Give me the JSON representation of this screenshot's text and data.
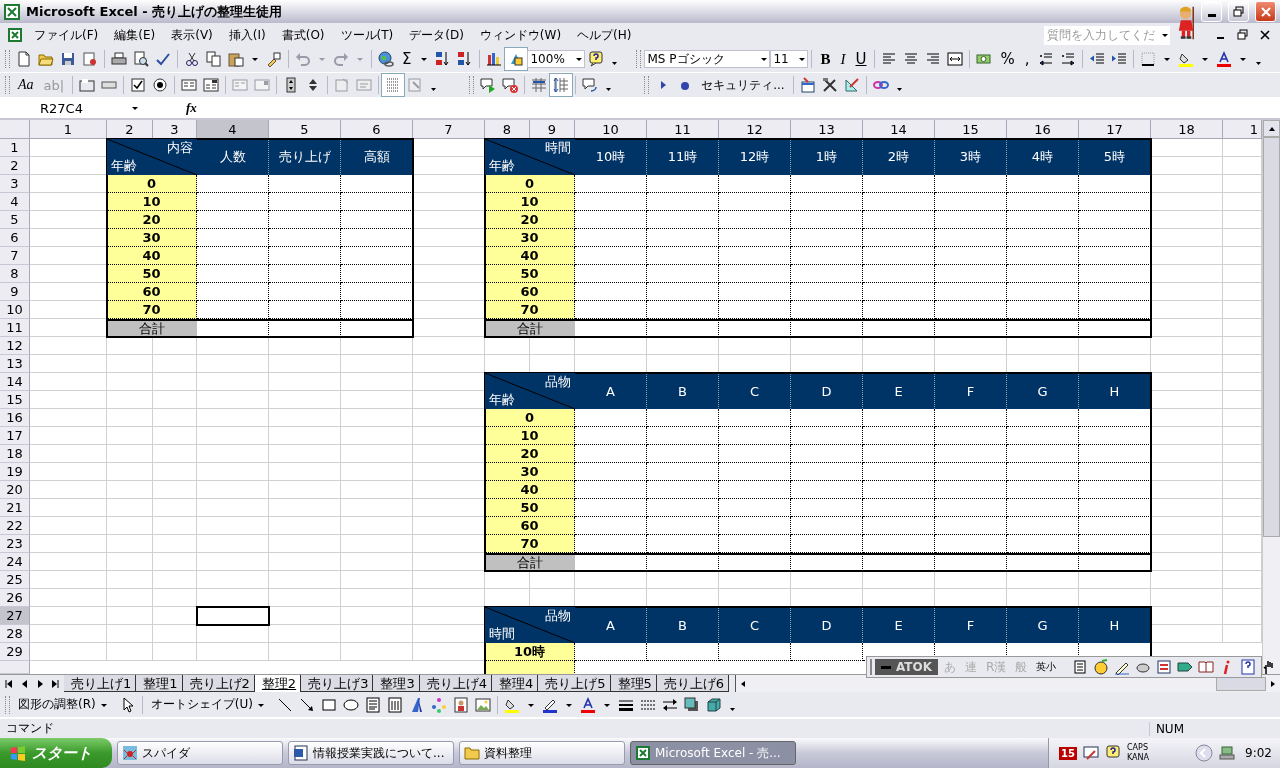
{
  "window": {
    "title": "Microsoft Excel - 売り上げの整理生徒用"
  },
  "menu": [
    "ファイル(F)",
    "編集(E)",
    "表示(V)",
    "挿入(I)",
    "書式(O)",
    "ツール(T)",
    "データ(D)",
    "ウィンドウ(W)",
    "ヘルプ(H)"
  ],
  "ask_box": {
    "placeholder": "質問を入力してくだ"
  },
  "standard_toolbar": {
    "autosum": "Σ",
    "zoom": "100%"
  },
  "formatting_toolbar": {
    "font": "MS Pゴシック",
    "size": "11",
    "bold": "B",
    "italic": "I",
    "underline": "U",
    "percent": "%",
    "comma": ","
  },
  "forms_toolbar": {
    "label_tool": "Aa",
    "edit_box_tool": "ab|",
    "security": "セキュリティ..."
  },
  "formula_bar": {
    "name_box": "R27C4",
    "function_label": "fx"
  },
  "sheet": {
    "column_headers": [
      {
        "label": "1",
        "selected": false
      },
      {
        "label": "2",
        "selected": false
      },
      {
        "label": "3",
        "selected": false
      },
      {
        "label": "4",
        "selected": true
      },
      {
        "label": "5",
        "selected": false
      },
      {
        "label": "6",
        "selected": false
      },
      {
        "label": "7",
        "selected": false
      },
      {
        "label": "8",
        "selected": false
      },
      {
        "label": "9",
        "selected": false
      },
      {
        "label": "10",
        "selected": false
      },
      {
        "label": "11",
        "selected": false
      },
      {
        "label": "12",
        "selected": false
      },
      {
        "label": "13",
        "selected": false
      },
      {
        "label": "14",
        "selected": false
      },
      {
        "label": "15",
        "selected": false
      },
      {
        "label": "16",
        "selected": false
      },
      {
        "label": "17",
        "selected": false
      },
      {
        "label": "18",
        "selected": false
      },
      {
        "label": "1",
        "selected": false
      }
    ],
    "row_headers": [
      {
        "label": "1",
        "selected": false
      },
      {
        "label": "2",
        "selected": false
      },
      {
        "label": "3",
        "selected": false
      },
      {
        "label": "4",
        "selected": false
      },
      {
        "label": "5",
        "selected": false
      },
      {
        "label": "6",
        "selected": false
      },
      {
        "label": "7",
        "selected": false
      },
      {
        "label": "8",
        "selected": false
      },
      {
        "label": "9",
        "selected": false
      },
      {
        "label": "10",
        "selected": false
      },
      {
        "label": "11",
        "selected": false
      },
      {
        "label": "12",
        "selected": false
      },
      {
        "label": "13",
        "selected": false
      },
      {
        "label": "14",
        "selected": false
      },
      {
        "label": "15",
        "selected": false
      },
      {
        "label": "16",
        "selected": false
      },
      {
        "label": "17",
        "selected": false
      },
      {
        "label": "18",
        "selected": false
      },
      {
        "label": "19",
        "selected": false
      },
      {
        "label": "20",
        "selected": false
      },
      {
        "label": "21",
        "selected": false
      },
      {
        "label": "22",
        "selected": false
      },
      {
        "label": "23",
        "selected": false
      },
      {
        "label": "24",
        "selected": false
      },
      {
        "label": "25",
        "selected": false
      },
      {
        "label": "26",
        "selected": false
      },
      {
        "label": "27",
        "selected": true
      },
      {
        "label": "28",
        "selected": false
      },
      {
        "label": "29",
        "selected": false
      }
    ],
    "tables": [
      {
        "corner_top": "内容",
        "corner_bottom": "年齢",
        "headers": [
          "人数",
          "売り上げ",
          "高額"
        ],
        "row_labels": [
          "0",
          "10",
          "20",
          "30",
          "40",
          "50",
          "60",
          "70"
        ],
        "total_label": "合計"
      },
      {
        "corner_top": "時間",
        "corner_bottom": "年齢",
        "headers": [
          "10時",
          "11時",
          "12時",
          "1時",
          "2時",
          "3時",
          "4時",
          "5時"
        ],
        "row_labels": [
          "0",
          "10",
          "20",
          "30",
          "40",
          "50",
          "60",
          "70"
        ],
        "total_label": "合計"
      },
      {
        "corner_top": "品物",
        "corner_bottom": "年齢",
        "headers": [
          "A",
          "B",
          "C",
          "D",
          "E",
          "F",
          "G",
          "H"
        ],
        "row_labels": [
          "0",
          "10",
          "20",
          "30",
          "40",
          "50",
          "60",
          "70"
        ],
        "total_label": "合計"
      },
      {
        "corner_top": "品物",
        "corner_bottom": "時間",
        "headers": [
          "A",
          "B",
          "C",
          "D",
          "E",
          "F",
          "G",
          "H"
        ],
        "row_labels": [
          "10時"
        ]
      }
    ]
  },
  "sheet_tabs": [
    {
      "label": "売り上げ1",
      "selected": false
    },
    {
      "label": "整理1",
      "selected": false
    },
    {
      "label": "売り上げ2",
      "selected": false
    },
    {
      "label": "整理2",
      "selected": true
    },
    {
      "label": "売り上げ3",
      "selected": false
    },
    {
      "label": "整理3",
      "selected": false
    },
    {
      "label": "売り上げ4",
      "selected": false
    },
    {
      "label": "整理4",
      "selected": false
    },
    {
      "label": "売り上げ5",
      "selected": false
    },
    {
      "label": "整理5",
      "selected": false
    },
    {
      "label": "売り上げ6",
      "selected": false
    }
  ],
  "atok_bar": {
    "logo": "ATOK",
    "modes": [
      {
        "label": "あ",
        "disabled": true
      },
      {
        "label": "連",
        "disabled": true
      },
      {
        "label": "R漢",
        "disabled": true
      },
      {
        "label": "般",
        "disabled": true
      },
      {
        "label": "英小",
        "disabled": false
      }
    ]
  },
  "drawing_toolbar": {
    "draw_menu": "図形の調整(R)",
    "autoshapes_menu": "オートシェイプ(U)"
  },
  "status_bar": {
    "mode": "コマンド",
    "num_lock": "NUM"
  },
  "taskbar": {
    "start": "スタート",
    "tasks": [
      {
        "label": "スパイダ",
        "selected": false
      },
      {
        "label": "情報授業実践について...",
        "selected": false
      },
      {
        "label": "資料整理",
        "selected": false
      },
      {
        "label": "Microsoft Excel - 売...",
        "selected": true
      }
    ],
    "tray": {
      "atok_version": "15",
      "caps": "CAPS",
      "kana": "KANA",
      "clock": "9:02"
    }
  }
}
